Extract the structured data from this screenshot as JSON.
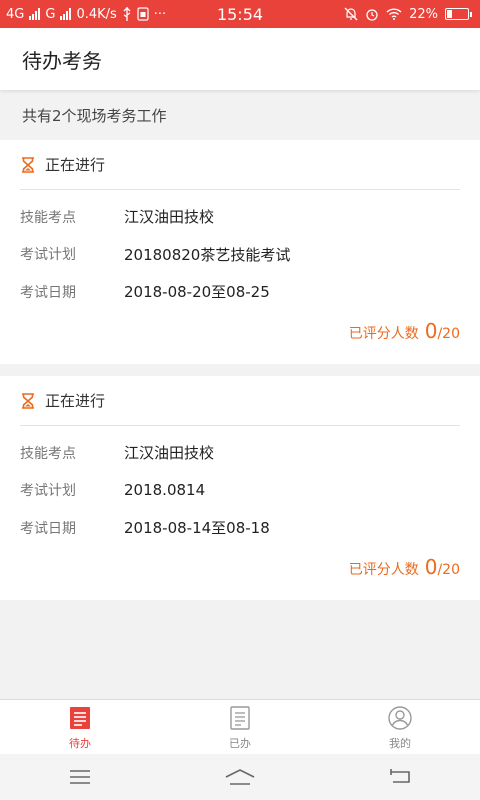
{
  "status_bar": {
    "left_network_1": "4G",
    "left_network_2": "G",
    "speed": "0.4K/s",
    "dots": "···",
    "time": "15:54",
    "battery": "22%",
    "icons": [
      "signal-icon",
      "usb-icon",
      "sim-icon",
      "mute-icon",
      "alarm-icon",
      "wifi-icon",
      "battery-icon"
    ],
    "background": "#e8423b"
  },
  "header": {
    "title": "待办考务"
  },
  "summary": "共有2个现场考务工作",
  "labels": {
    "site": "技能考点",
    "plan": "考试计划",
    "date": "考试日期",
    "scored": "已评分人数"
  },
  "tasks": [
    {
      "status": "正在进行",
      "site": "江汉油田技校",
      "plan": "20180820茶艺技能考试",
      "date": "2018-08-20至08-25",
      "scored": "0",
      "total": "/20"
    },
    {
      "status": "正在进行",
      "site": "江汉油田技校",
      "plan": "2018.0814",
      "date": "2018-08-14至08-18",
      "scored": "0",
      "total": "/20"
    }
  ],
  "tabs": [
    {
      "label": "待办",
      "icon": "todo-list-icon",
      "active": true
    },
    {
      "label": "已办",
      "icon": "done-document-icon",
      "active": false
    },
    {
      "label": "我的",
      "icon": "profile-icon",
      "active": false
    }
  ],
  "colors": {
    "accent": "#e8423b",
    "score": "#ee6a1d"
  }
}
